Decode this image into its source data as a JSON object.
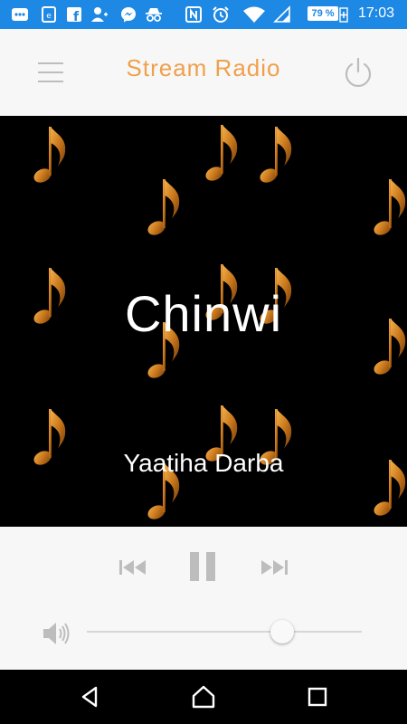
{
  "status_bar": {
    "battery_percent": "79 %",
    "time": "17:03",
    "icons": [
      "more-icon",
      "messaging-icon",
      "facebook-icon",
      "add-contact-icon",
      "messenger-icon",
      "incognito-icon",
      "nfc-icon",
      "alarm-icon",
      "wifi-icon",
      "signal-icon",
      "battery-icon"
    ]
  },
  "toolbar": {
    "title": "Stream Radio",
    "menu_icon": "menu-icon",
    "power_icon": "power-icon"
  },
  "now_playing": {
    "title": "Chinwi",
    "artist": "Yaatiha Darba"
  },
  "player": {
    "prev_icon": "skip-previous-icon",
    "pause_icon": "pause-icon",
    "next_icon": "skip-next-icon",
    "volume_icon": "volume-icon",
    "volume_level": 0.71
  },
  "nav_bar": {
    "back_icon": "back-icon",
    "home_icon": "home-icon",
    "recents_icon": "recents-icon"
  },
  "colors": {
    "status_bar": "#1e88e5",
    "title_accent": "#f0a04b",
    "note_gold": "#d28a2a",
    "control_gray": "#bdbdbd"
  }
}
